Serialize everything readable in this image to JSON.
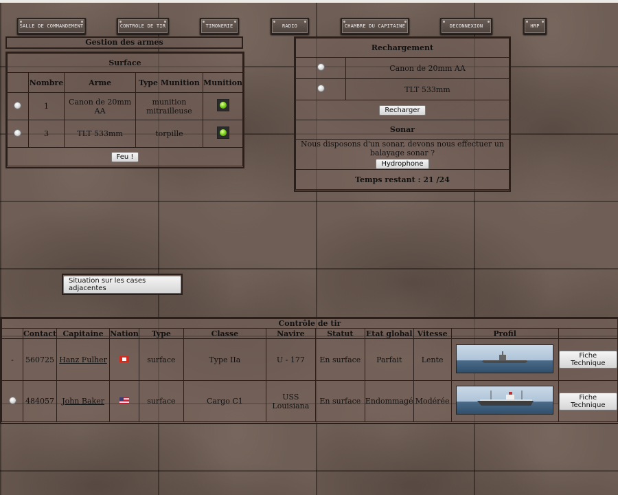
{
  "nav": [
    {
      "label": "Salle de commandement"
    },
    {
      "label": "Controle de tir"
    },
    {
      "label": "Timonerie"
    },
    {
      "label": "Radio"
    },
    {
      "label": "Chambre du capitaine"
    },
    {
      "label": "Deconnexion"
    },
    {
      "label": "HRP"
    }
  ],
  "gestion": {
    "title": "Gestion des armes",
    "surface_title": "Surface",
    "headers": [
      "Nombre",
      "Arme",
      "Type Munition",
      "Munition"
    ],
    "rows": [
      {
        "nombre": "1",
        "arme": "Canon de 20mm AA",
        "type": "munition mitrailleuse"
      },
      {
        "nombre": "3",
        "arme": "TLT 533mm",
        "type": "torpille"
      }
    ],
    "fire_label": "Feu !"
  },
  "recharge": {
    "title": "Rechargement",
    "rows": [
      "Canon de 20mm AA",
      "TLT 533mm"
    ],
    "reload_label": "Recharger",
    "sonar_title": "Sonar",
    "sonar_text": "Nous disposons d'un sonar, devons nous effectuer un balayage sonar ?",
    "hydro_label": "Hydrophone",
    "time_text": "Temps restant : 21 /24"
  },
  "situation_label": "Situation sur les cases adjacentes",
  "controle": {
    "title": "Contrôle de tir",
    "headers": [
      "Contact",
      "Capitaine",
      "Nation",
      "Type",
      "Classe",
      "Navire",
      "Statut",
      "Etat global",
      "Vitesse",
      "Profil"
    ],
    "rows": [
      {
        "select": "-",
        "contact": "560725",
        "capitaine": "Hanz Fulher",
        "type": "surface",
        "classe": "Type IIa",
        "navire": "U - 177",
        "statut": "En surface",
        "etat": "Parfait",
        "vitesse": "Lente",
        "fiche": "Fiche Technique"
      },
      {
        "select": "",
        "contact": "484057",
        "capitaine": "John Baker",
        "type": "surface",
        "classe": "Cargo C1",
        "navire": "USS Louisiana",
        "statut": "En surface",
        "etat": "Endommagé",
        "vitesse": "Modérée",
        "fiche": "Fiche Technique"
      }
    ]
  }
}
